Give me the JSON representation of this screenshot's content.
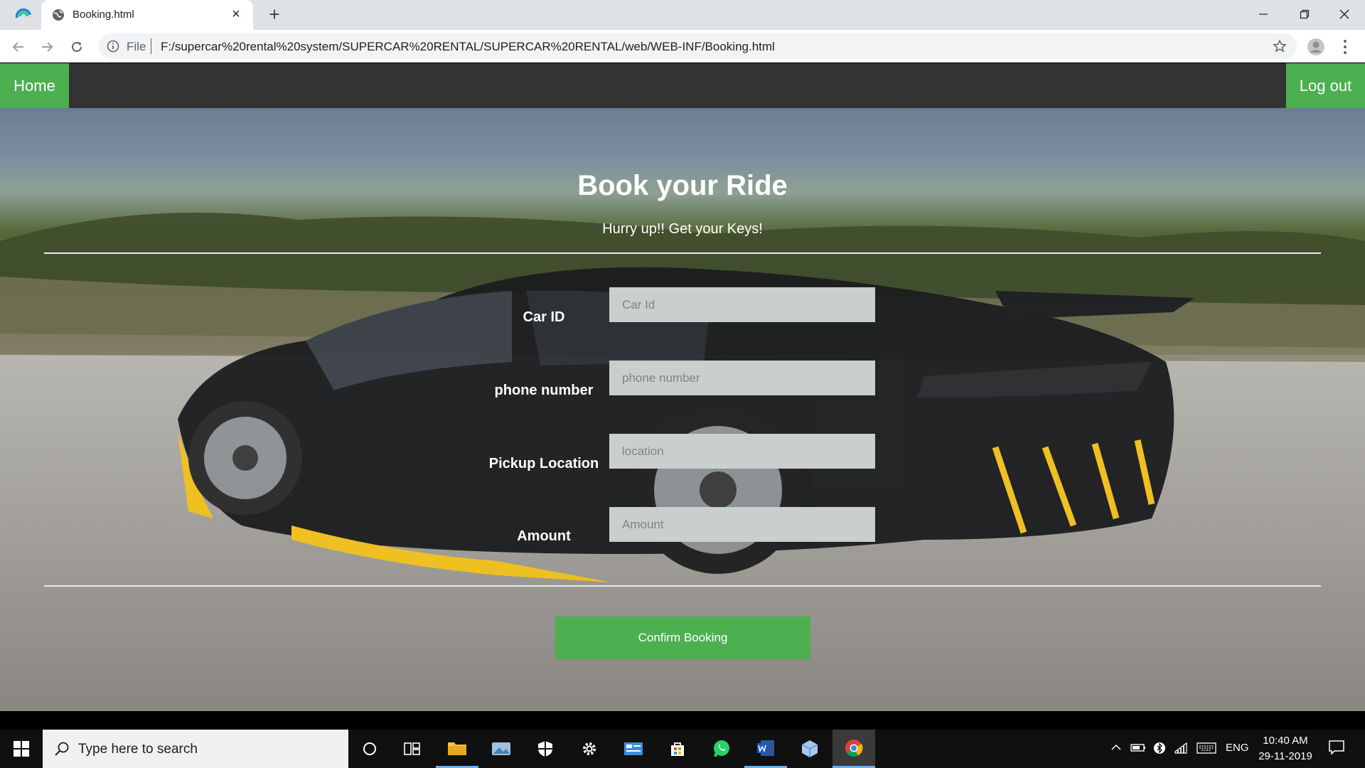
{
  "browser": {
    "tab_title": "Booking.html",
    "new_tab_symbol": "+",
    "close_symbol": "×",
    "scheme_label": "File",
    "url": "F:/supercar%20rental%20system/SUPERCAR%20RENTAL/SUPERCAR%20RENTAL/web/WEB-INF/Booking.html",
    "icons": [
      "back-arrow",
      "forward-arrow",
      "reload",
      "info",
      "star",
      "profile",
      "menu-kebab",
      "minimize",
      "maximize",
      "close"
    ]
  },
  "nav": {
    "home": "Home",
    "logout": "Log out"
  },
  "hero": {
    "title": "Book your Ride",
    "subtitle": "Hurry up!! Get your Keys!"
  },
  "form": {
    "fields": [
      {
        "label": "Car ID",
        "placeholder": "Car Id",
        "value": ""
      },
      {
        "label": "phone number",
        "placeholder": "phone number",
        "value": ""
      },
      {
        "label": "Pickup Location",
        "placeholder": "location",
        "value": ""
      },
      {
        "label": "Amount",
        "placeholder": "Amount",
        "value": ""
      }
    ],
    "submit": "Confirm Booking"
  },
  "colors": {
    "accent": "#4caf50",
    "navbar": "#333333",
    "input_bg": "#c8cfcd"
  },
  "taskbar": {
    "search_placeholder": "Type here to search",
    "language": "ENG",
    "time": "10:40 AM",
    "date": "29-11-2019",
    "apps": [
      "cortana",
      "task-view",
      "file-explorer",
      "photos",
      "windows-security",
      "settings",
      "control-panel",
      "microsoft-store",
      "whatsapp",
      "word",
      "3d-app",
      "chrome"
    ]
  }
}
